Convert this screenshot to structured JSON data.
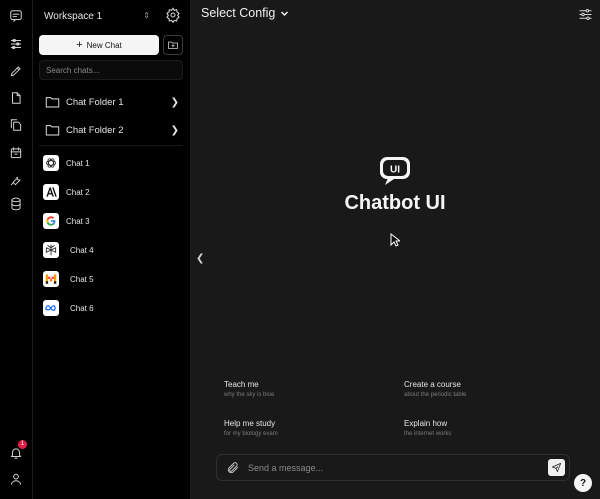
{
  "colors": {
    "main_bg": "#1a191a",
    "sidebar_bg": "#000000",
    "accent_white": "#f5f5f5",
    "badge": "#e11d48"
  },
  "rail": {
    "icons": [
      "chat-icon",
      "sliders-icon",
      "pencil-icon",
      "file-icon",
      "files-icon",
      "calendar-icon",
      "wrench-icon",
      "database-icon"
    ],
    "notifications_count": "1",
    "bottom_icons": [
      "bell-icon",
      "user-icon"
    ]
  },
  "sidebar": {
    "workspace": "Workspace 1",
    "new_chat_label": "New Chat",
    "search_placeholder": "Search chats...",
    "folders": [
      {
        "label": "Chat Folder 1"
      },
      {
        "label": "Chat Folder 2"
      }
    ],
    "chats": [
      {
        "label": "Chat 1",
        "logo": "openai-logo"
      },
      {
        "label": "Chat 2",
        "logo": "anthropic-logo"
      },
      {
        "label": "Chat 3",
        "logo": "google-logo"
      },
      {
        "label": "Chat 4",
        "logo": "perplexity-logo"
      },
      {
        "label": "Chat 5",
        "logo": "mistral-logo"
      },
      {
        "label": "Chat 6",
        "logo": "meta-logo"
      }
    ]
  },
  "main": {
    "config_label": "Select Config",
    "brand_badge": "UI",
    "brand_title": "Chatbot UI",
    "collapse_glyph": "❮",
    "prompts": [
      {
        "title": "Teach me",
        "subtitle": "why the sky is blue"
      },
      {
        "title": "Create a course",
        "subtitle": "about the periodic table"
      },
      {
        "title": "Help me study",
        "subtitle": "for my biology exam"
      },
      {
        "title": "Explain how",
        "subtitle": "the internet works"
      }
    ],
    "input_placeholder": "Send a message...",
    "help_label": "?"
  }
}
